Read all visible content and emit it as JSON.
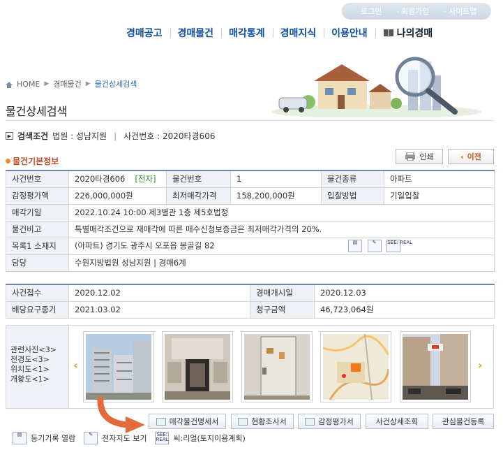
{
  "util": [
    "로그인",
    "회원가입",
    "사이트맵"
  ],
  "nav": [
    "경매공고",
    "경매물건",
    "매각통계",
    "경매지식",
    "이용안내",
    "나의경매"
  ],
  "breadcrumb": [
    "HOME",
    "경매물건",
    "물건상세검색"
  ],
  "page_title": "물건상세검색",
  "condition": {
    "title": "검색조건",
    "court": "법원 : 성남지원",
    "case": "사건번호 : 2020타경606"
  },
  "section_title": "물건기본정보",
  "buttons": {
    "print": "인쇄",
    "prev": "이전"
  },
  "basic": {
    "case_no_label": "사건번호",
    "case_no": "2020타경606",
    "electronic": "[전자]",
    "item_no_label": "물건번호",
    "item_no": "1",
    "item_type_label": "물건종류",
    "item_type": "아파트",
    "appraisal_label": "감정평가액",
    "appraisal": "226,000,000원",
    "min_price_label": "최저매각가격",
    "min_price": "158,200,000원",
    "bid_method_label": "입찰방법",
    "bid_method": "기일입찰",
    "sale_date_label": "매각기일",
    "sale_date": "2022.10.24 10:00 제3별관 1층 제5호법정",
    "remark_label": "물건비고",
    "remark": "특별매각조건으로 재매각에 따른 매수신청보증금은 최저매각가격의 20%.",
    "location_label": "목록1 소재지",
    "location": "(아파트) 경기도 광주시 오포읍 봉골길 82",
    "manager_label": "담당",
    "manager": "수원지방법원 성남지원 | 경매6계"
  },
  "dates": {
    "receipt_label": "사건접수",
    "receipt": "2020.12.02",
    "start_label": "경매개시일",
    "start": "2020.12.03",
    "deadline_label": "배당요구종기",
    "deadline": "2021.03.02",
    "claim_label": "청구금액",
    "claim": "46,723,064원"
  },
  "photo_labels": [
    "관련사진<3>",
    "전경도<3>",
    "위치도<1>",
    "개황도<1>"
  ],
  "actions": [
    "매각물건명세서",
    "현황조사서",
    "감정평가서",
    "사건상세조회",
    "관심물건등록"
  ],
  "legend": [
    "등기기록 열람",
    "전자지도 보기",
    "씨:리얼(토지이용계획)"
  ],
  "icon_texts": {
    "seereal": "SEE: REAL"
  }
}
